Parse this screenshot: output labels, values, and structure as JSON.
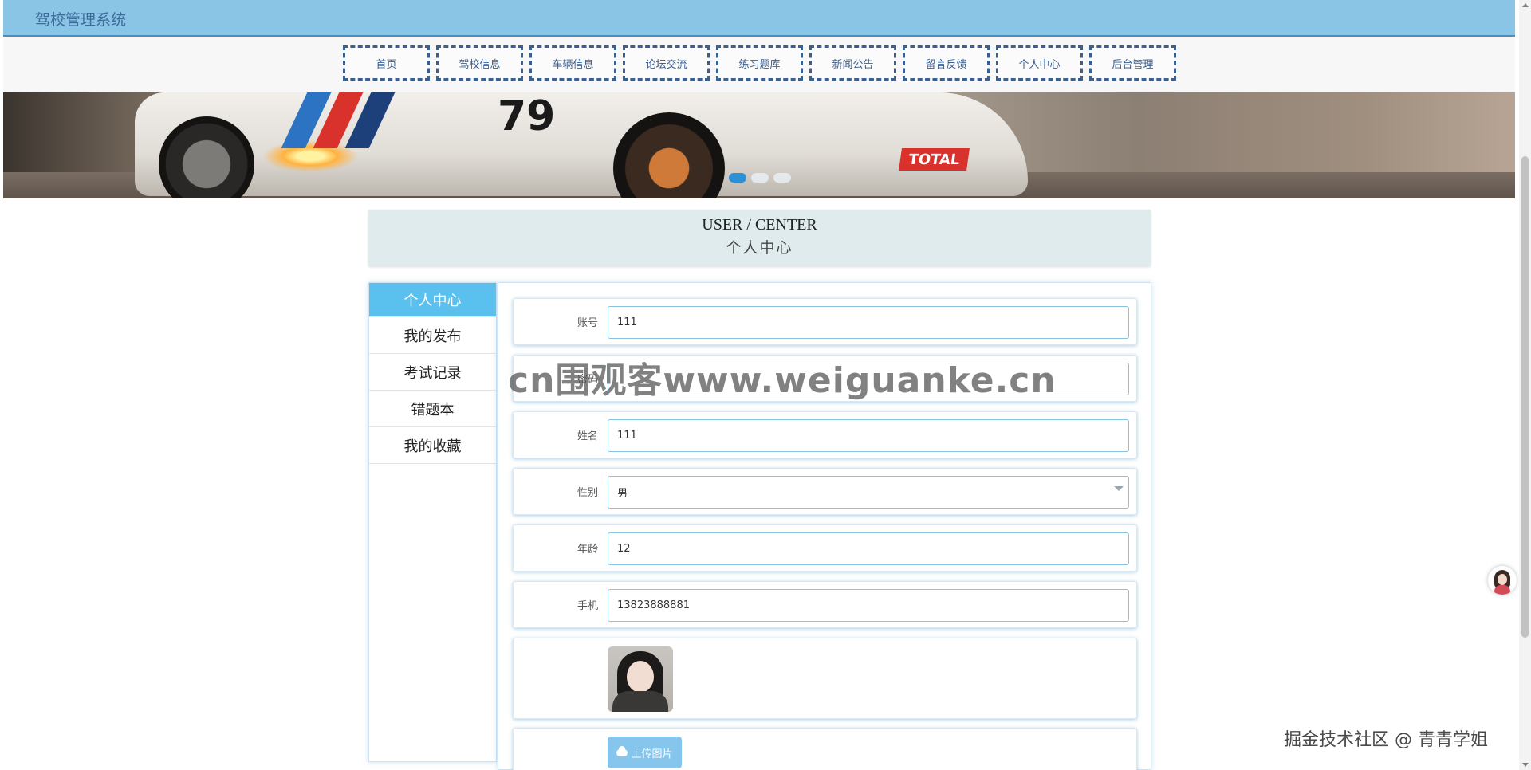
{
  "app": {
    "title": "驾校管理系统"
  },
  "nav": {
    "items": [
      "首页",
      "驾校信息",
      "车辆信息",
      "论坛交流",
      "练习题库",
      "新闻公告",
      "留言反馈",
      "个人中心",
      "后台管理"
    ]
  },
  "banner": {
    "slide_count": 3,
    "active_slide": 1,
    "car_number": "79",
    "sponsor": "TOTAL"
  },
  "section": {
    "title_en": "USER / CENTER",
    "title_cn": "个人中心"
  },
  "sidebar": {
    "items": [
      {
        "label": "个人中心",
        "active": true
      },
      {
        "label": "我的发布",
        "active": false
      },
      {
        "label": "考试记录",
        "active": false
      },
      {
        "label": "错题本",
        "active": false
      },
      {
        "label": "我的收藏",
        "active": false
      }
    ]
  },
  "form": {
    "account": {
      "label": "账号",
      "value": "111"
    },
    "password": {
      "label": "密码",
      "value": ""
    },
    "name": {
      "label": "姓名",
      "value": "111"
    },
    "gender": {
      "label": "性别",
      "value": "男"
    },
    "age": {
      "label": "年龄",
      "value": "12"
    },
    "phone": {
      "label": "手机",
      "value": "13823888881"
    },
    "upload_label": "上传图片"
  },
  "watermark": "cn围观客www.weiguanke.cn",
  "credit": "掘金技术社区 @ 青青学姐",
  "colors": {
    "header_bg": "#8ac5e5",
    "nav_border": "#3a5f91",
    "active_menu": "#5ac1ef",
    "field_border": "#87c3e3",
    "upload_button": "#87c6ec"
  }
}
